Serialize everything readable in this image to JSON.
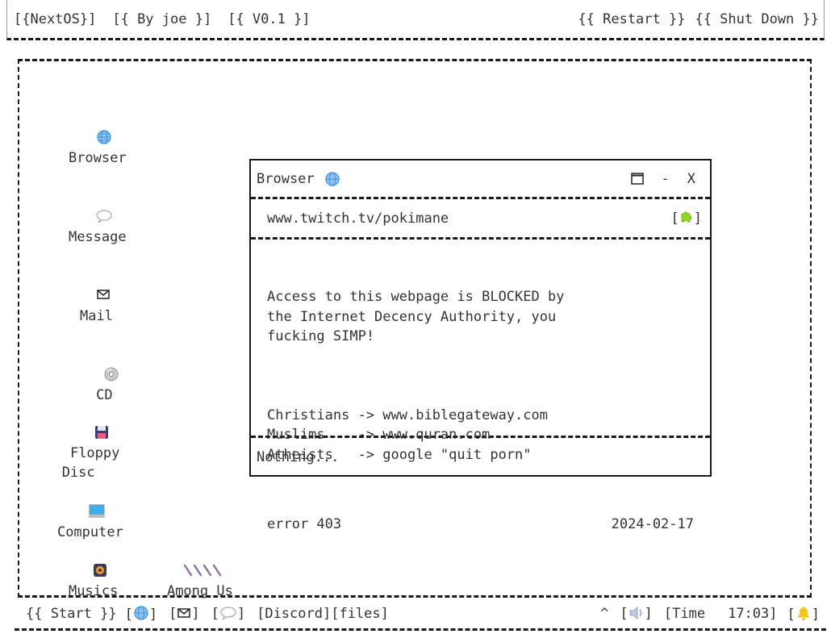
{
  "topbar": {
    "os_name": "[{NextOS}]",
    "author": "[{ By joe }]",
    "version": "[{ V0.1 }]",
    "restart": "{{ Restart }}",
    "shutdown": "{{ Shut Down }}"
  },
  "desktop": {
    "icons": [
      {
        "label": "Browser",
        "icon": "globe-icon"
      },
      {
        "label": "Message",
        "icon": "speech-bubble-icon"
      },
      {
        "label": "Mail",
        "icon": "envelope-icon"
      },
      {
        "label": "CD",
        "icon": "cd-icon"
      },
      {
        "label": "Floppy\nDisc",
        "icon": "floppy-disk-icon"
      },
      {
        "label": "Computer",
        "icon": "computer-icon"
      },
      {
        "label": "Musics",
        "icon": "music-icon"
      },
      {
        "label": "Among Us",
        "icon": "among-us-icon"
      }
    ]
  },
  "window": {
    "title": "Browser",
    "maximize": "☐",
    "minimize": "-",
    "close": "X",
    "url": "www.twitch.tv/pokimane",
    "extension_open": "[",
    "extension_close": "]",
    "message": "Access to this webpage is BLOCKED by\nthe Internet Decency Authority, you\nfucking SIMP!",
    "suggestions": "Christians -> www.biblegateway.com\nMuslims    -> www.quran.com\nAtheists   -> google \"quit porn\"",
    "error_code": "error 403",
    "date": "2024-02-17",
    "status": "Nothing..."
  },
  "taskbar": {
    "start": "{{ Start }}",
    "browser_open": "[",
    "browser_close": "]",
    "mail_open": "[",
    "mail_close": "]",
    "message_open": "[",
    "message_close": "]",
    "discord": "[Discord]",
    "files": "[files]",
    "tray_caret": "^",
    "volume_open": "[",
    "volume_close": "]",
    "time_label": "[Time",
    "time": "17:03]",
    "bell_open": "[",
    "bell_close": "]"
  }
}
